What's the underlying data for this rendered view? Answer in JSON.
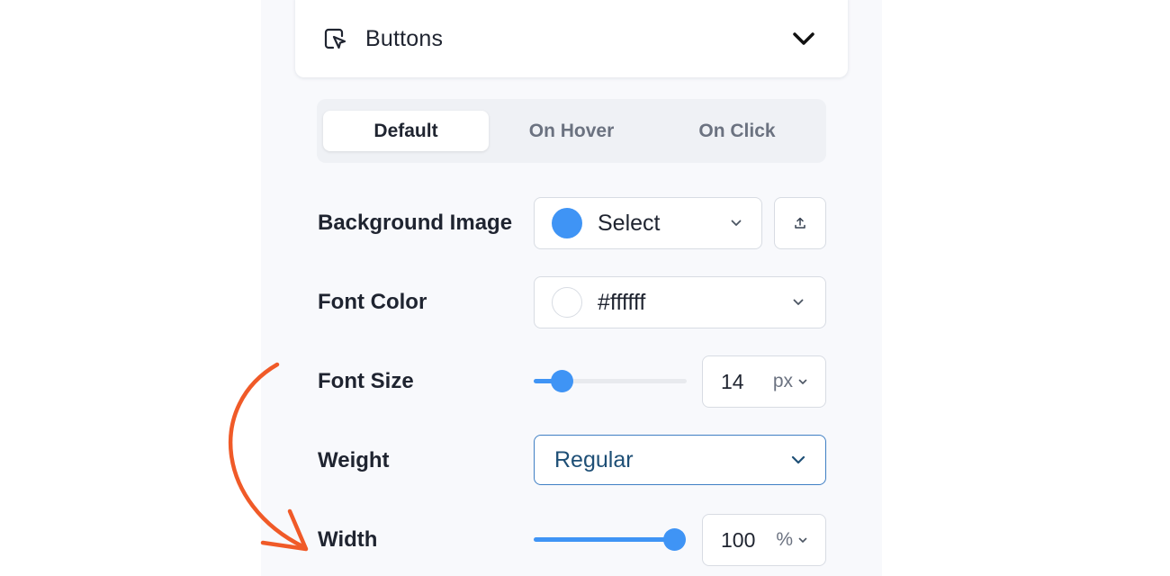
{
  "section": {
    "title": "Buttons",
    "icon": "cursor-click-icon"
  },
  "tabs": [
    {
      "label": "Default",
      "active": true
    },
    {
      "label": "On Hover",
      "active": false
    },
    {
      "label": "On Click",
      "active": false
    }
  ],
  "background_image": {
    "label": "Background Image",
    "value": "Select",
    "swatch_color": "#3f94f5",
    "upload_icon": "upload-icon"
  },
  "font_color": {
    "label": "Font Color",
    "value": "#ffffff"
  },
  "font_size": {
    "label": "Font Size",
    "value": "14",
    "unit": "px",
    "slider_fraction": 0.18
  },
  "weight": {
    "label": "Weight",
    "value": "Regular"
  },
  "width": {
    "label": "Width",
    "value": "100",
    "unit": "%",
    "slider_fraction": 1.0
  },
  "colors": {
    "accent": "#3f94f5",
    "annotation_arrow": "#f05a28"
  }
}
